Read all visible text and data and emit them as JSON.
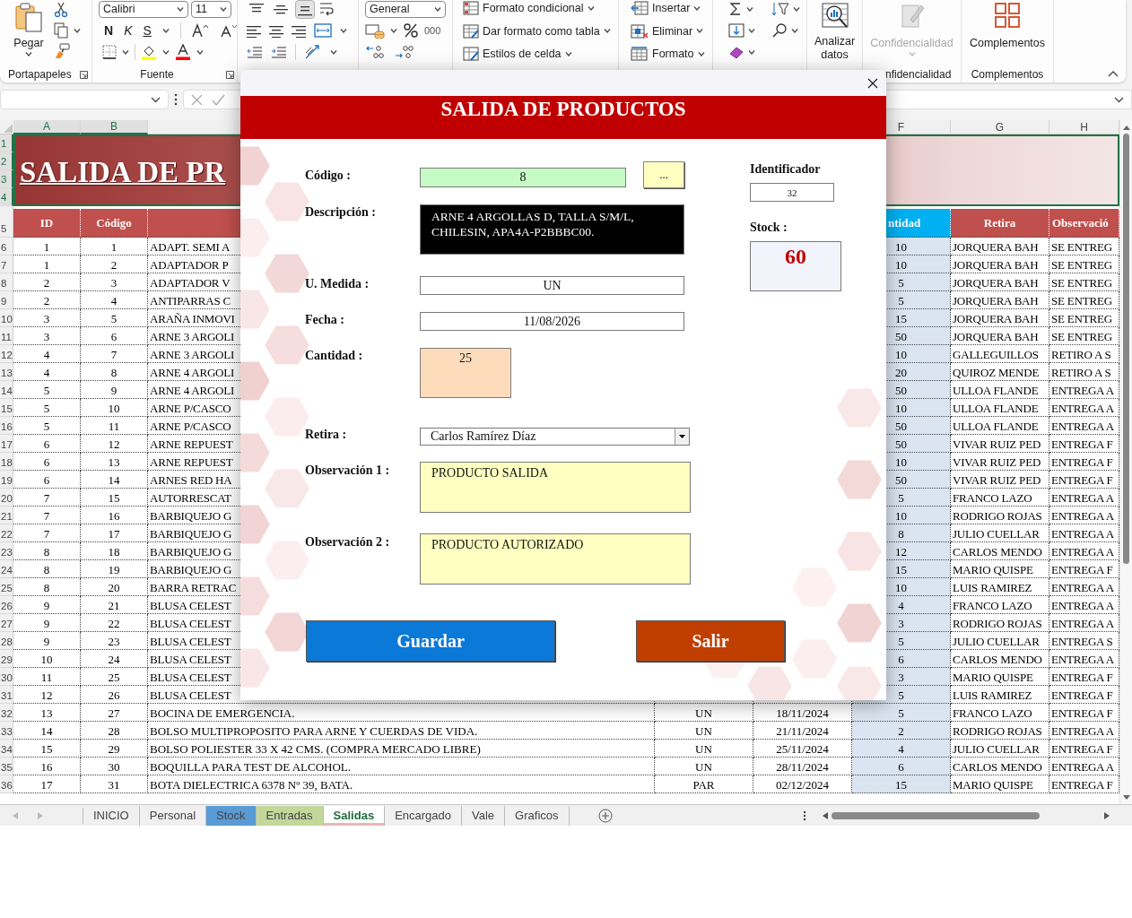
{
  "ribbon": {
    "paste": "Pegar",
    "clipboard_label": "Portapapeles",
    "font_name": "Calibri",
    "font_size": "11",
    "bold": "N",
    "italic": "K",
    "underline": "S",
    "font_label": "Fuente",
    "vertical_align": [
      {
        "selected": false
      },
      {
        "selected": false
      },
      {
        "selected": true
      }
    ],
    "number_format": "General",
    "thousands": "000",
    "styles": [
      "Formato condicional",
      "Dar formato como tabla",
      "Estilos de celda"
    ],
    "cells": [
      "Insertar",
      "Eliminar",
      "Formato"
    ],
    "analyze": "Analizar datos",
    "sensitivity": {
      "label": "Confidencialidad",
      "disabled": true,
      "group_label": "nfidencialidad"
    },
    "addins": {
      "label": "Complementos",
      "group_label": "Complementos"
    }
  },
  "sheet": {
    "column_headers": [
      {
        "label": "A",
        "selected": true
      },
      {
        "label": "B",
        "selected": true
      },
      {
        "label": "F",
        "selected": false
      },
      {
        "label": "G",
        "selected": false
      },
      {
        "label": "H",
        "selected": false
      }
    ],
    "banner_rows": [
      {
        "label": "1",
        "selected": true
      },
      {
        "label": "2",
        "selected": true
      },
      {
        "label": "3",
        "selected": true
      },
      {
        "label": "4",
        "selected": true
      }
    ],
    "title": "SALIDA DE PR",
    "header": {
      "row": "5",
      "id": "ID",
      "code": "Código",
      "quantity": "ntidad",
      "retira": "Retira",
      "observation": "Observació"
    },
    "rows": [
      {
        "row": "6",
        "id": "1",
        "code": "1",
        "description": "ADAPT. SEMI A",
        "quantity": "10",
        "retira": "JORQUERA BAH",
        "observation": "SE ENTREG"
      },
      {
        "row": "7",
        "id": "1",
        "code": "2",
        "description": "ADAPTADOR P",
        "quantity": "10",
        "retira": "JORQUERA BAH",
        "observation": "SE ENTREG"
      },
      {
        "row": "8",
        "id": "2",
        "code": "3",
        "description": "ADAPTADOR V",
        "quantity": "5",
        "retira": "JORQUERA BAH",
        "observation": "SE ENTREG"
      },
      {
        "row": "9",
        "id": "2",
        "code": "4",
        "description": "ANTIPARRAS C",
        "quantity": "5",
        "retira": "JORQUERA BAH",
        "observation": "SE ENTREG"
      },
      {
        "row": "10",
        "id": "3",
        "code": "5",
        "description": "ARAÑA INMOVI",
        "quantity": "15",
        "retira": "JORQUERA BAH",
        "observation": "SE ENTREG"
      },
      {
        "row": "11",
        "id": "3",
        "code": "6",
        "description": "ARNE 3 ARGOLI",
        "quantity": "50",
        "retira": "JORQUERA BAH",
        "observation": "SE ENTREG"
      },
      {
        "row": "12",
        "id": "4",
        "code": "7",
        "description": "ARNE 3 ARGOLI",
        "quantity": "10",
        "retira": "GALLEGUILLOS",
        "observation": "RETIRO A S"
      },
      {
        "row": "13",
        "id": "4",
        "code": "8",
        "description": "ARNE 4 ARGOLI",
        "quantity": "20",
        "retira": "QUIROZ MENDE",
        "observation": "RETIRO A S"
      },
      {
        "row": "14",
        "id": "5",
        "code": "9",
        "description": "ARNE 4 ARGOLI",
        "quantity": "50",
        "retira": "ULLOA FLANDE",
        "observation": "ENTREGA A"
      },
      {
        "row": "15",
        "id": "5",
        "code": "10",
        "description": "ARNE P/CASCO",
        "quantity": "10",
        "retira": "ULLOA FLANDE",
        "observation": "ENTREGA A"
      },
      {
        "row": "16",
        "id": "5",
        "code": "11",
        "description": "ARNE P/CASCO",
        "quantity": "50",
        "retira": "ULLOA FLANDE",
        "observation": "ENTREGA A"
      },
      {
        "row": "17",
        "id": "6",
        "code": "12",
        "description": "ARNE REPUEST",
        "quantity": "50",
        "retira": "VIVAR RUIZ PED",
        "observation": "ENTREGA F"
      },
      {
        "row": "18",
        "id": "6",
        "code": "13",
        "description": "ARNE REPUEST",
        "quantity": "10",
        "retira": "VIVAR RUIZ PED",
        "observation": "ENTREGA F"
      },
      {
        "row": "19",
        "id": "6",
        "code": "14",
        "description": "ARNES RED HA",
        "quantity": "50",
        "retira": "VIVAR RUIZ PED",
        "observation": "ENTREGA F"
      },
      {
        "row": "20",
        "id": "7",
        "code": "15",
        "description": "AUTORRESCAT",
        "quantity": "5",
        "retira": "FRANCO LAZO",
        "observation": "ENTREGA A"
      },
      {
        "row": "21",
        "id": "7",
        "code": "16",
        "description": "BARBIQUEJO G",
        "quantity": "10",
        "retira": "RODRIGO ROJAS",
        "observation": "ENTREGA A"
      },
      {
        "row": "22",
        "id": "7",
        "code": "17",
        "description": "BARBIQUEJO G",
        "quantity": "8",
        "retira": "JULIO CUELLAR",
        "observation": "ENTREGA A"
      },
      {
        "row": "23",
        "id": "8",
        "code": "18",
        "description": "BARBIQUEJO G",
        "quantity": "12",
        "retira": "CARLOS MENDO",
        "observation": "ENTREGA A"
      },
      {
        "row": "24",
        "id": "8",
        "code": "19",
        "description": "BARBIQUEJO G",
        "quantity": "15",
        "retira": "MARIO QUISPE",
        "observation": "ENTREGA F"
      },
      {
        "row": "25",
        "id": "8",
        "code": "20",
        "description": "BARRA RETRAC",
        "quantity": "10",
        "retira": "LUIS RAMIREZ",
        "observation": "ENTREGA A"
      },
      {
        "row": "26",
        "id": "9",
        "code": "21",
        "description": "BLUSA CELEST",
        "quantity": "4",
        "retira": "FRANCO LAZO",
        "observation": "ENTREGA A"
      },
      {
        "row": "27",
        "id": "9",
        "code": "22",
        "description": "BLUSA CELEST",
        "quantity": "3",
        "retira": "RODRIGO ROJAS",
        "observation": "ENTREGA A"
      },
      {
        "row": "28",
        "id": "9",
        "code": "23",
        "description": "BLUSA CELEST",
        "quantity": "5",
        "retira": "JULIO CUELLAR",
        "observation": "ENTREGA S"
      },
      {
        "row": "29",
        "id": "10",
        "code": "24",
        "description": "BLUSA CELEST",
        "quantity": "6",
        "retira": "CARLOS MENDO",
        "observation": "ENTREGA A"
      },
      {
        "row": "30",
        "id": "11",
        "code": "25",
        "description": "BLUSA CELEST",
        "quantity": "3",
        "retira": "MARIO QUISPE",
        "observation": "ENTREGA F"
      },
      {
        "row": "31",
        "id": "12",
        "code": "26",
        "description": "BLUSA CELEST",
        "quantity": "5",
        "retira": "LUIS RAMIREZ",
        "observation": "ENTREGA F"
      },
      {
        "row": "32",
        "id": "13",
        "code": "27",
        "description": "BOCINA DE EMERGENCIA.",
        "unit": "UN",
        "date": "18/11/2024",
        "quantity": "5",
        "retira": "FRANCO LAZO",
        "observation": "ENTREGA F"
      },
      {
        "row": "33",
        "id": "14",
        "code": "28",
        "description": "BOLSO MULTIPROPOSITO PARA ARNE Y CUERDAS DE VIDA.",
        "unit": "UN",
        "date": "21/11/2024",
        "quantity": "2",
        "retira": "RODRIGO ROJAS",
        "observation": "ENTREGA A"
      },
      {
        "row": "34",
        "id": "15",
        "code": "29",
        "description": "BOLSO POLIESTER 33 X 42 CMS. (COMPRA MERCADO LIBRE)",
        "unit": "UN",
        "date": "25/11/2024",
        "quantity": "4",
        "retira": "JULIO CUELLAR",
        "observation": "ENTREGA F"
      },
      {
        "row": "35",
        "id": "16",
        "code": "30",
        "description": "BOQUILLA PARA TEST DE ALCOHOL.",
        "unit": "UN",
        "date": "28/11/2024",
        "quantity": "6",
        "retira": "CARLOS MENDO",
        "observation": "ENTREGA A"
      },
      {
        "row": "36",
        "id": "17",
        "code": "31",
        "description": "BOTA DIELECTRICA 6378 Nº 39, BATA.",
        "unit": "PAR",
        "date": "02/12/2024",
        "quantity": "15",
        "retira": "MARIO QUISPE",
        "observation": "ENTREGA F"
      }
    ]
  },
  "sheet_tabs": [
    {
      "label": "INICIO",
      "selected": false
    },
    {
      "label": "Personal",
      "selected": false
    },
    {
      "label": "Stock",
      "selected": false,
      "color": "#5b9bd5"
    },
    {
      "label": "Entradas",
      "selected": false,
      "color": "#c4d79b"
    },
    {
      "label": "Salidas",
      "selected": true,
      "color": "#e6b8b7"
    },
    {
      "label": "Encargado",
      "selected": false
    },
    {
      "label": "Vale",
      "selected": false
    },
    {
      "label": "Graficos",
      "selected": false
    }
  ],
  "dialog": {
    "title": "SALIDA DE PRODUCTOS",
    "code": {
      "label": "Código :",
      "value": "8",
      "lookup": "..."
    },
    "identifier": {
      "label": "Identificador",
      "value": "32"
    },
    "description": {
      "label": "Descripción :",
      "value": "ARNE 4 ARGOLLAS D, TALLA S/M/L, CHILESIN, APA4A-P2BBBC00."
    },
    "stock": {
      "label": "Stock :",
      "value": "60"
    },
    "unit": {
      "label": "U. Medida :",
      "value": "UN"
    },
    "date": {
      "label": "Fecha :",
      "value": "11/08/2026"
    },
    "quantity": {
      "label": "Cantidad :",
      "value": "25"
    },
    "retira": {
      "label": "Retira :",
      "value": "Carlos Ramírez Díaz"
    },
    "observation_1": {
      "label": "Observación 1 :",
      "value": "PRODUCTO SALIDA"
    },
    "observation_2": {
      "label": "Observación 2 :",
      "value": "PRODUCTO AUTORIZADO"
    },
    "buttons": [
      {
        "label": "Guardar",
        "kind": "save"
      },
      {
        "label": "Salir",
        "kind": "exit"
      }
    ]
  }
}
